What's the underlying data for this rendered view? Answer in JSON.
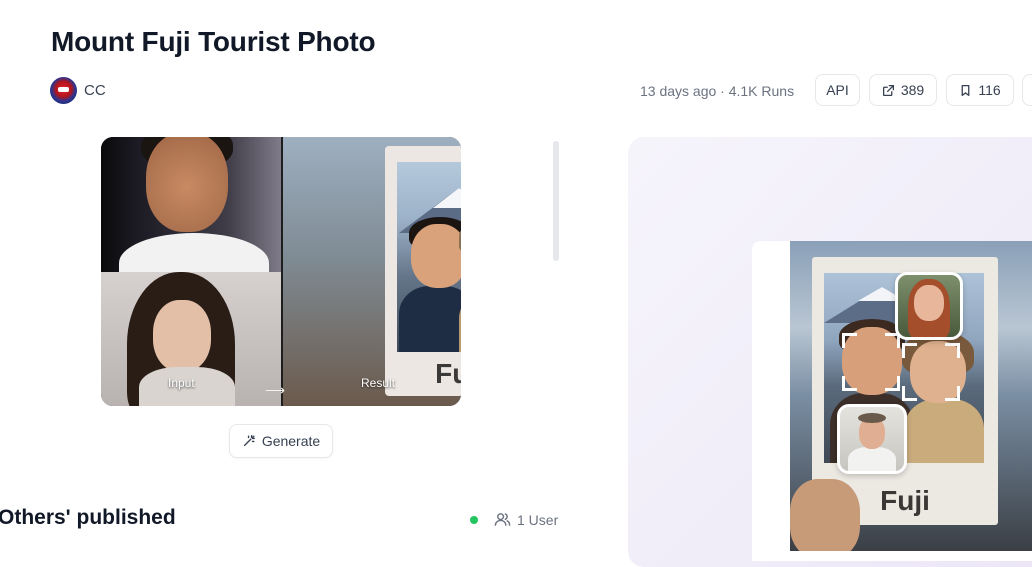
{
  "page": {
    "title": "Mount Fuji Tourist Photo",
    "author": {
      "name": "CC",
      "avatar_icon": "spiderman-avatar"
    },
    "meta_text": "13 days ago · 4.1K Runs"
  },
  "toolbar": {
    "api_label": "API",
    "share_count": "389",
    "share_icon": "external-link-icon",
    "bookmark_count": "116",
    "bookmark_icon": "bookmark-icon"
  },
  "preview": {
    "input_label": "Input",
    "result_label": "Result",
    "frame_text": "Fuji"
  },
  "generate": {
    "label": "Generate",
    "icon": "magic-wand-icon"
  },
  "others": {
    "heading": "Others' published",
    "online_color": "#22c55e",
    "users_label": "1 User",
    "users_icon": "users-icon"
  },
  "demo": {
    "frame_text": "Fuji"
  }
}
